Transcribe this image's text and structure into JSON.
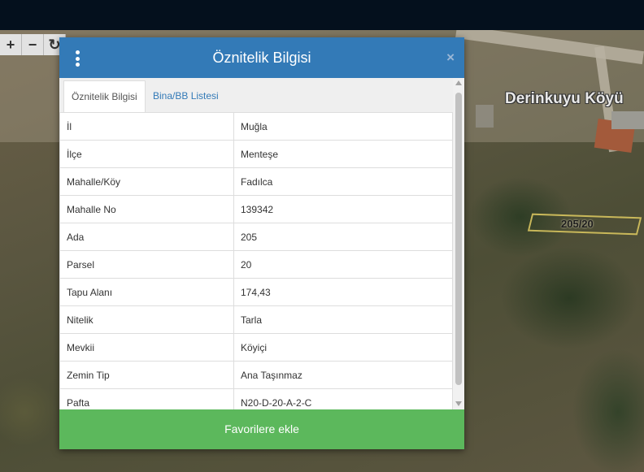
{
  "map": {
    "village_label": "Derinkuyu Köyü",
    "parcel_label": "205/20",
    "toolbar": {
      "zoom_in": "+",
      "zoom_out": "−",
      "refresh": "↻"
    }
  },
  "dialog": {
    "title": "Öznitelik Bilgisi",
    "close": "×",
    "tabs": [
      {
        "label": "Öznitelik Bilgisi",
        "active": true
      },
      {
        "label": "Bina/BB Listesi",
        "active": false
      }
    ],
    "rows": [
      {
        "key": "İl",
        "value": "Muğla"
      },
      {
        "key": "İlçe",
        "value": "Menteşe"
      },
      {
        "key": "Mahalle/Köy",
        "value": "Fadılca"
      },
      {
        "key": "Mahalle No",
        "value": "139342"
      },
      {
        "key": "Ada",
        "value": "205"
      },
      {
        "key": "Parsel",
        "value": "20"
      },
      {
        "key": "Tapu Alanı",
        "value": "174,43"
      },
      {
        "key": "Nitelik",
        "value": "Tarla"
      },
      {
        "key": "Mevkii",
        "value": "Köyiçi"
      },
      {
        "key": "Zemin Tip",
        "value": "Ana Taşınmaz"
      },
      {
        "key": "Pafta",
        "value": "N20-D-20-A-2-C"
      }
    ],
    "favorite_button": "Favorilere ekle"
  },
  "colors": {
    "header": "#337ab7",
    "favorite": "#5cb85c",
    "topbar": "#04101d"
  }
}
